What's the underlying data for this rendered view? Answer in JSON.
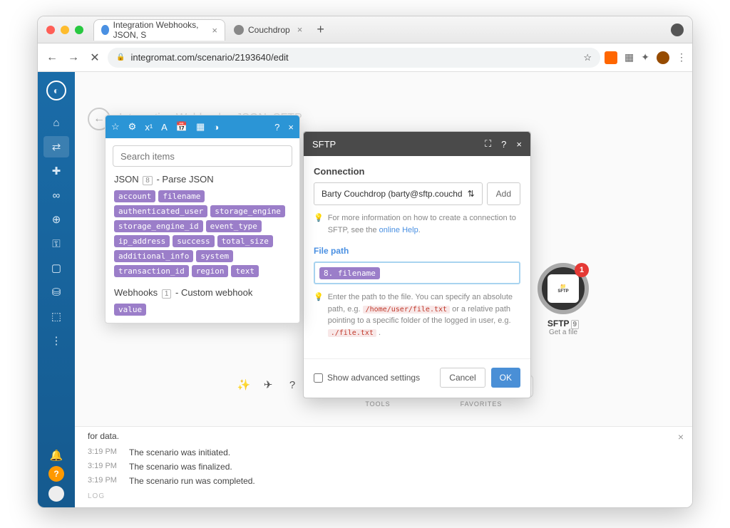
{
  "browser": {
    "tabs": [
      {
        "title": "Integration Webhooks, JSON, S",
        "active": true
      },
      {
        "title": "Couchdrop",
        "active": false
      }
    ],
    "url": "integromat.com/scenario/2193640/edit"
  },
  "page": {
    "faint_title": "Integration Webhooks, JSON, SFTP"
  },
  "items_panel": {
    "search_placeholder": "Search items",
    "section1_prefix": "JSON",
    "section1_num": "8",
    "section1_suffix": " - Parse JSON",
    "section1_pills": [
      "account",
      "filename",
      "authenticated_user",
      "storage_engine",
      "storage_engine_id",
      "event_type",
      "ip_address",
      "success",
      "total_size",
      "additional_info",
      "system",
      "transaction_id",
      "region",
      "text"
    ],
    "section2_prefix": "Webhooks",
    "section2_num": "1",
    "section2_suffix": " - Custom webhook",
    "section2_pills": [
      "value"
    ]
  },
  "sftp_popup": {
    "title": "SFTP",
    "connection_label": "Connection",
    "connection_value": "Barty Couchdrop (barty@sftp.couchd",
    "add_label": "Add",
    "conn_hint_a": "For more information on how to create a connection to SFTP, see the ",
    "conn_hint_link": "online Help",
    "file_path_label": "File path",
    "file_path_token": "8. filename",
    "path_hint_a": "Enter the path to the file. You can specify an absolute path, e.g. ",
    "path_code1": "/home/user/file.txt",
    "path_hint_b": " or a relative path pointing to a specific folder of the logged in user, e.g. ",
    "path_code2": "./file.txt",
    "advanced_label": "Show advanced settings",
    "cancel": "Cancel",
    "ok": "OK"
  },
  "node": {
    "badge": "1",
    "label": "SFTP",
    "num": "9",
    "sub": "Get a file"
  },
  "toolbar": {
    "tools_label": "TOOLS",
    "favorites_label": "FAVORITES"
  },
  "log": {
    "header_tail": "for data.",
    "rows": [
      {
        "time": "3:19 PM",
        "msg": "The scenario was initiated."
      },
      {
        "time": "3:19 PM",
        "msg": "The scenario was finalized."
      },
      {
        "time": "3:19 PM",
        "msg": "The scenario run was completed."
      }
    ],
    "footer": "LOG"
  }
}
